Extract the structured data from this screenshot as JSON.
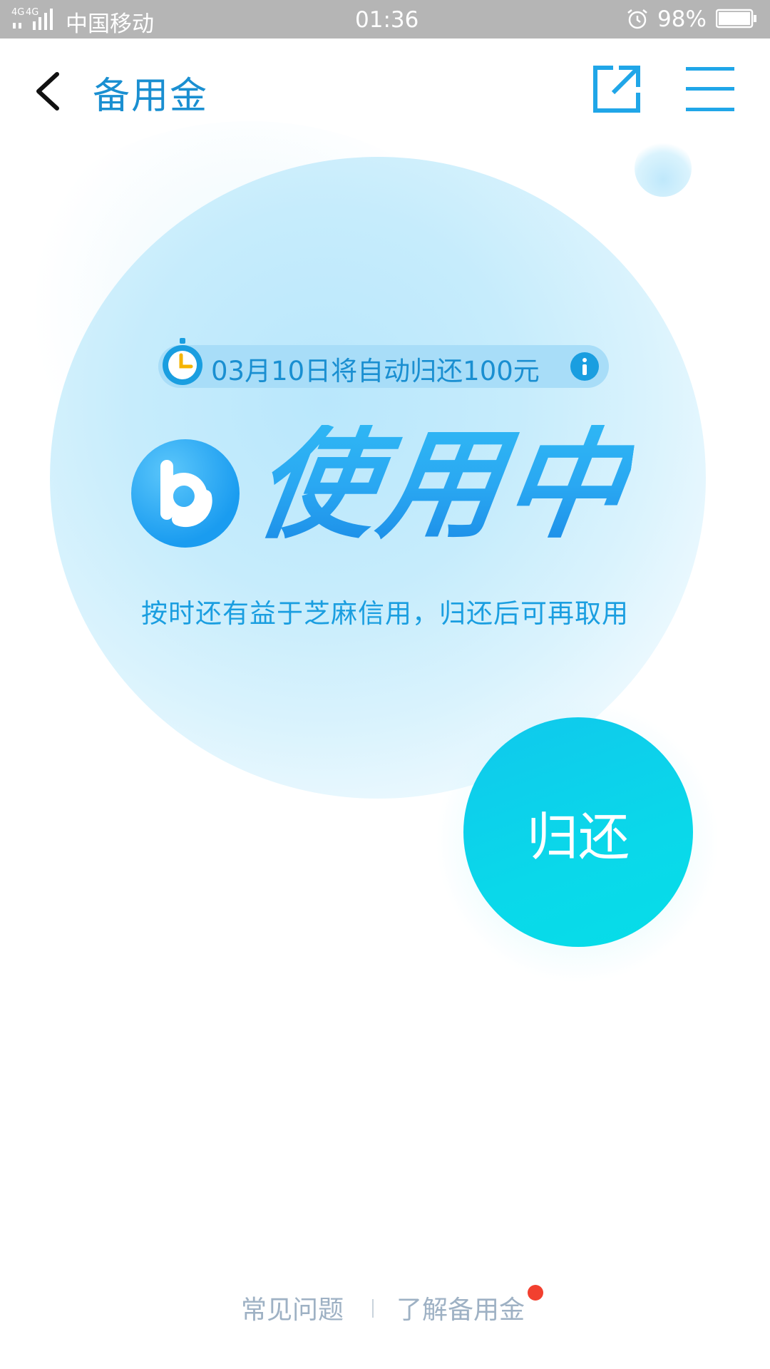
{
  "status_bar": {
    "network": "4G 4G",
    "carrier": "中国移动",
    "time": "01:36",
    "battery": "98%",
    "battery_level": 0.98
  },
  "header": {
    "title": "备用金",
    "back_icon": "chevron-left-icon",
    "share_icon": "external-link-icon",
    "menu_icon": "hamburger-menu-icon"
  },
  "main": {
    "auto_return_text": "03月10日将自动归还100元",
    "status_text": "使用中",
    "subtitle": "按时还有益于芝麻信用，归还后可再取用",
    "return_button_label": "归还"
  },
  "footer": {
    "faq_label": "常见问题",
    "learn_label": "了解备用金"
  },
  "colors": {
    "accent": "#1a8fd1",
    "return_button": "#0ad8ea",
    "notification_dot": "#f2402f"
  }
}
